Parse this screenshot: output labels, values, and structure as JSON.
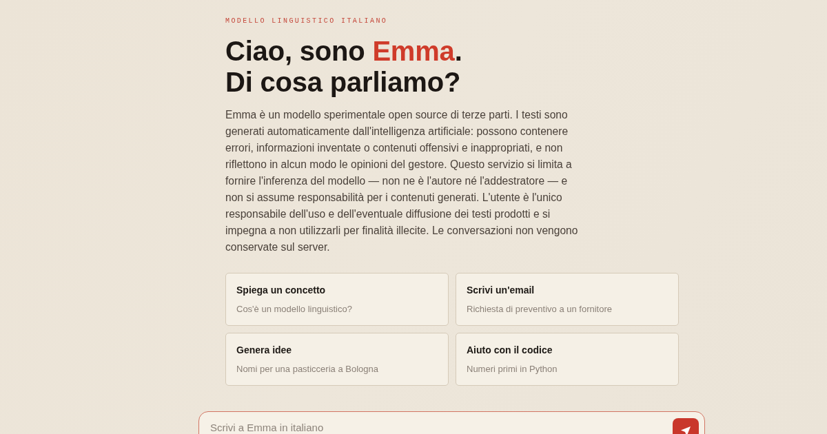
{
  "eyebrow": "MODELLO LINGUISTICO ITALIANO",
  "heading": {
    "lines": [
      {
        "parts": [
          {
            "text": "Ciao, sono ",
            "accent": false
          },
          {
            "text": "Emma",
            "accent": true
          },
          {
            "text": ".",
            "accent": false
          }
        ]
      },
      {
        "parts": [
          {
            "text": "Di cosa parliamo?",
            "accent": false
          }
        ]
      }
    ]
  },
  "disclaimer": "Emma è un modello sperimentale open source di terze parti. I testi sono generati automaticamente dall'intelligenza artificiale: possono contenere errori, informazioni inventate o contenuti offensivi e inappropriati, e non riflettono in alcun modo le opinioni del gestore. Questo servizio si limita a fornire l'inferenza del modello — non ne è l'autore né l'addestratore — e non si assume responsabilità per i contenuti generati. L'utente è l'unico responsabile dell'uso e dell'eventuale diffusione dei testi prodotti e si impegna a non utilizzarli per finalità illecite. Le conversazioni non vengono conservate sul server.",
  "suggestions": [
    {
      "title": "Spiega un concetto",
      "subtitle": "Cos'è un modello linguistico?"
    },
    {
      "title": "Scrivi un'email",
      "subtitle": "Richiesta di preventivo a un fornitore"
    },
    {
      "title": "Genera idee",
      "subtitle": "Nomi per una pasticceria a Bologna"
    },
    {
      "title": "Aiuto con il codice",
      "subtitle": "Numeri primi in Python"
    }
  ],
  "composer": {
    "placeholder": "Scrivi a Emma in italiano"
  }
}
